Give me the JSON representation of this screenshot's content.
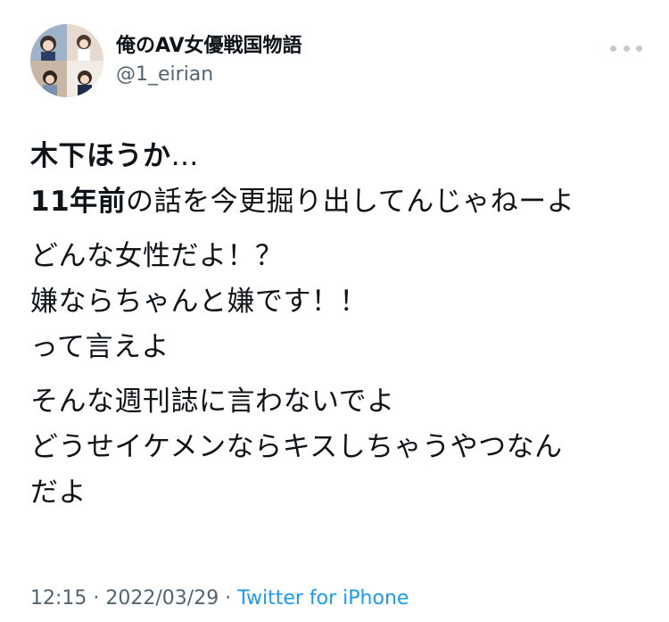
{
  "user": {
    "display_name": "俺のAV女優戦国物語",
    "handle": "@1_eirian"
  },
  "tweet": {
    "title_name": "木下ほうか",
    "title_ellipsis": "…",
    "line2_bold": "11年前",
    "line2_rest": "の話を今更掘り出してんじゃねーよ",
    "paragraph2": [
      "どんな女性だよ！？",
      "嫌ならちゃんと嫌です！！",
      "って言えよ"
    ],
    "paragraph3": [
      "そんな週刊誌に言わないでよ",
      "どうせイケメンならキスしちゃうやつなん",
      "だよ"
    ]
  },
  "meta": {
    "time": "12:15",
    "separator1": " · ",
    "date": "2022/03/29",
    "separator2": " · ",
    "source": "Twitter for iPhone"
  },
  "icons": {
    "more": "more-horizontal-icon",
    "avatar": "profile-avatar"
  },
  "colors": {
    "text": "#0f1419",
    "secondary": "#536471",
    "link": "#1d9bf0"
  }
}
